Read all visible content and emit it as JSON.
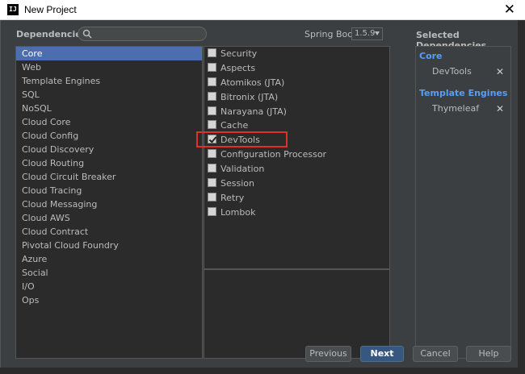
{
  "window": {
    "title": "New Project",
    "app_icon": "IJ"
  },
  "header": {
    "dependencies_label": "Dependencies",
    "search_placeholder": "",
    "spring_boot_label": "Spring Boot",
    "spring_boot_version": "1.5.9"
  },
  "categories": [
    {
      "label": "Core",
      "selected": true
    },
    {
      "label": "Web"
    },
    {
      "label": "Template Engines"
    },
    {
      "label": "SQL"
    },
    {
      "label": "NoSQL"
    },
    {
      "label": "Cloud Core"
    },
    {
      "label": "Cloud Config"
    },
    {
      "label": "Cloud Discovery"
    },
    {
      "label": "Cloud Routing"
    },
    {
      "label": "Cloud Circuit Breaker"
    },
    {
      "label": "Cloud Tracing"
    },
    {
      "label": "Cloud Messaging"
    },
    {
      "label": "Cloud AWS"
    },
    {
      "label": "Cloud Contract"
    },
    {
      "label": "Pivotal Cloud Foundry"
    },
    {
      "label": "Azure"
    },
    {
      "label": "Social"
    },
    {
      "label": "I/O"
    },
    {
      "label": "Ops"
    }
  ],
  "dependencies": [
    {
      "label": "Security",
      "checked": false
    },
    {
      "label": "Aspects",
      "checked": false
    },
    {
      "label": "Atomikos (JTA)",
      "checked": false
    },
    {
      "label": "Bitronix (JTA)",
      "checked": false
    },
    {
      "label": "Narayana (JTA)",
      "checked": false
    },
    {
      "label": "Cache",
      "checked": false
    },
    {
      "label": "DevTools",
      "checked": true
    },
    {
      "label": "Configuration Processor",
      "checked": false
    },
    {
      "label": "Validation",
      "checked": false
    },
    {
      "label": "Session",
      "checked": false
    },
    {
      "label": "Retry",
      "checked": false
    },
    {
      "label": "Lombok",
      "checked": false
    }
  ],
  "selected_panel": {
    "title": "Selected Dependencies",
    "groups": [
      {
        "name": "Core",
        "items": [
          "DevTools"
        ]
      },
      {
        "name": "Template Engines",
        "items": [
          "Thymeleaf"
        ]
      }
    ],
    "remove_glyph": "✕"
  },
  "buttons": {
    "previous": "Previous",
    "next": "Next",
    "cancel": "Cancel",
    "help": "Help"
  },
  "colors": {
    "selection": "#4b6eaf",
    "group_header": "#589df6",
    "highlight": "#e0302c",
    "default_button": "#365880"
  }
}
